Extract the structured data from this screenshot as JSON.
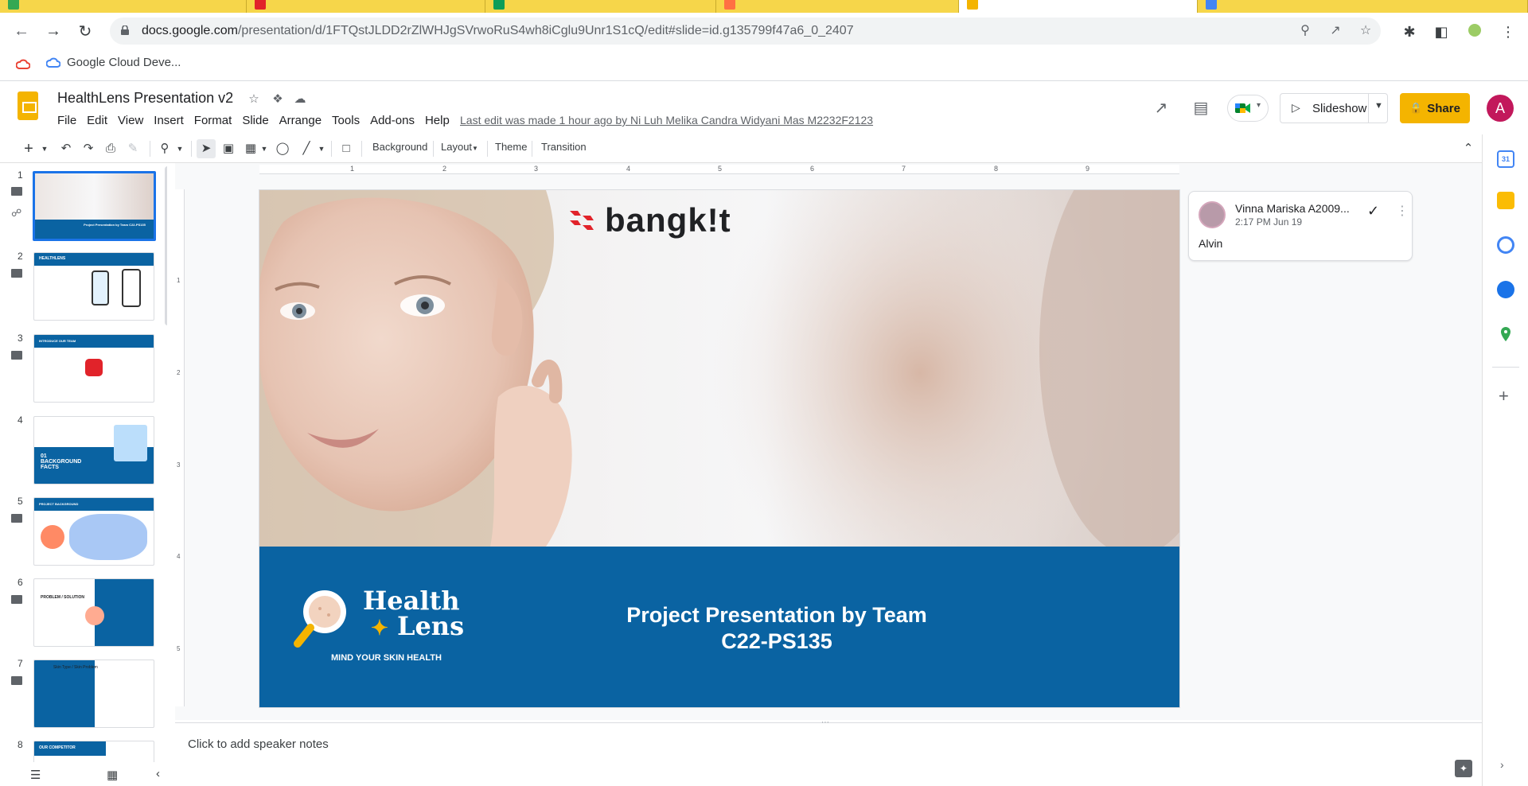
{
  "browser": {
    "url_domain": "docs.google.com",
    "url_path": "/presentation/d/1FTQstJLDD2rZlWHJgSVrwoRuS4wh8iCglu9Unr1S1cQ/edit#slide=id.g135799f47a6_0_2407",
    "bookmark_label": "Google Cloud Deve..."
  },
  "doc": {
    "title": "HealthLens Presentation v2",
    "menu": [
      "File",
      "Edit",
      "View",
      "Insert",
      "Format",
      "Slide",
      "Arrange",
      "Tools",
      "Add-ons",
      "Help"
    ],
    "last_edit": "Last edit was made 1 hour ago by Ni Luh Melika Candra Widyani Mas M2232F2123",
    "slideshow_label": "Slideshow",
    "share_label": "Share",
    "avatar_letter": "A"
  },
  "toolbar": {
    "background": "Background",
    "layout": "Layout",
    "theme": "Theme",
    "transition": "Transition"
  },
  "ruler": {
    "h_labels": [
      "1",
      "2",
      "3",
      "4",
      "5",
      "6",
      "7",
      "8",
      "9"
    ],
    "v_labels": [
      "1",
      "2",
      "3",
      "4",
      "5"
    ]
  },
  "thumbnails": [
    {
      "num": "1",
      "comments": true,
      "title": "Project Presentation by Team C22-PS135"
    },
    {
      "num": "2",
      "comments": true,
      "title": "HEALTHLENS"
    },
    {
      "num": "3",
      "comments": true,
      "title": "INTRODUCE OUR TEAM"
    },
    {
      "num": "4",
      "comments": false,
      "title": "01 BACKGROUND FACTS"
    },
    {
      "num": "5",
      "comments": true,
      "title": "PROJECT BACKGROUND"
    },
    {
      "num": "6",
      "comments": true,
      "title": "PROBLEM / SOLUTION"
    },
    {
      "num": "7",
      "comments": true,
      "title": "Skin Type / Skin Problem"
    },
    {
      "num": "8",
      "comments": false,
      "title": "OUR COMPETITOR"
    }
  ],
  "slide": {
    "brand": "bangk!t",
    "logo_line1": "Health",
    "logo_line2": "Lens",
    "logo_tagline": "MIND YOUR SKIN HEALTH",
    "title_line1": "Project Presentation by Team",
    "title_line2": "C22-PS135"
  },
  "notes": {
    "placeholder": "Click to add speaker notes"
  },
  "comment": {
    "author": "Vinna Mariska A2009...",
    "time": "2:17 PM Jun 19",
    "body": "Alvin"
  },
  "colors": {
    "accent": "#f4b400",
    "slide_blue": "#0a63a2",
    "selection": "#1a73e8",
    "bangkit_red": "#e1232a"
  }
}
